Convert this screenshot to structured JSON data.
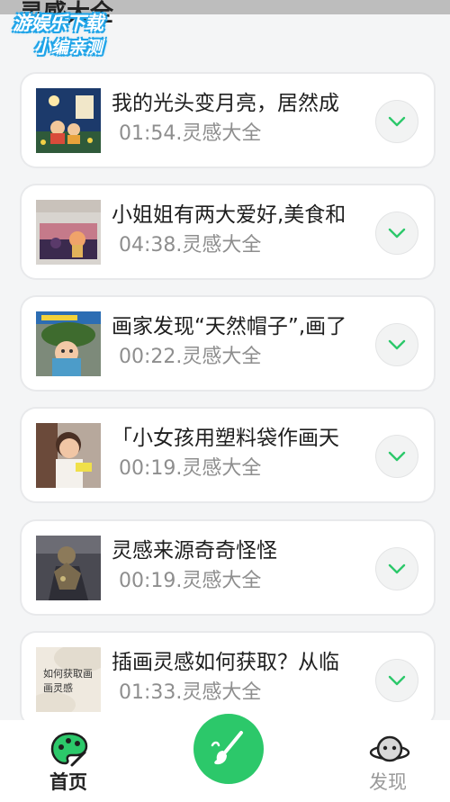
{
  "header": {
    "title": "灵感大全"
  },
  "watermark": {
    "line1": "游娱乐下载",
    "line2": "小编亲测"
  },
  "items": [
    {
      "title": "我的光头变月亮，居然成",
      "meta": "01:54.灵感大全"
    },
    {
      "title": "小姐姐有两大爱好,美食和",
      "meta": "04:38.灵感大全"
    },
    {
      "title": "画家发现“天然帽子”,画了",
      "meta": "00:22.灵感大全"
    },
    {
      "title": "「小女孩用塑料袋作画天",
      "meta": "00:19.灵感大全"
    },
    {
      "title": "灵感来源奇奇怪怪",
      "meta": "00:19.灵感大全"
    },
    {
      "title": "插画灵感如何获取？从临",
      "meta": "01:33.灵感大全"
    }
  ],
  "thumbs": {
    "item6_caption": "如何获取画画灵感"
  },
  "tabbar": {
    "home_label": "首页",
    "discover_label": "发现",
    "home_icon": "palette-icon",
    "fab_icon": "brush-icon",
    "discover_icon": "planet-icon"
  },
  "colors": {
    "accent": "#2cc86a",
    "chevron": "#2cc86a"
  }
}
